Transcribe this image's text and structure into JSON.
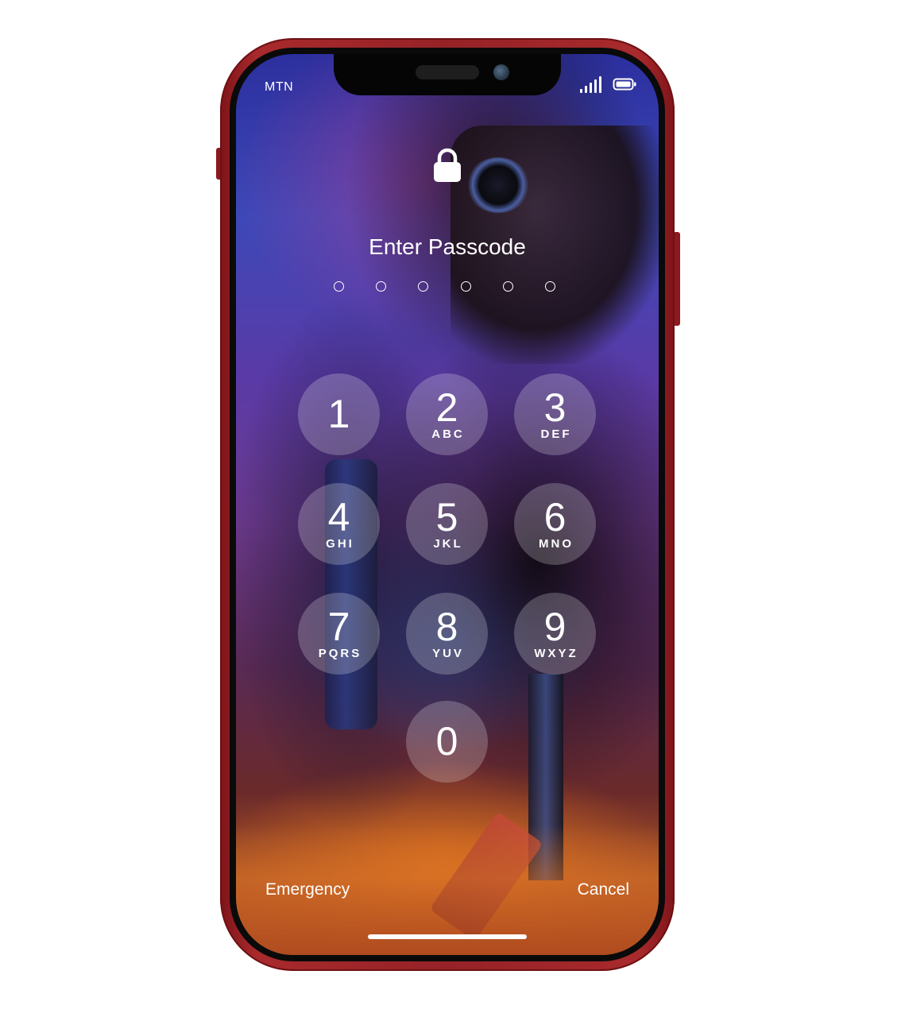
{
  "status_bar": {
    "carrier": "MTN",
    "signal_icon": "cellular-signal-icon",
    "battery_icon": "battery-icon"
  },
  "lock": {
    "icon": "lock-icon",
    "title": "Enter Passcode",
    "passcode_length": 6,
    "entered_digits": 0
  },
  "keypad": {
    "keys": [
      {
        "digit": "1",
        "letters": ""
      },
      {
        "digit": "2",
        "letters": "ABC"
      },
      {
        "digit": "3",
        "letters": "DEF"
      },
      {
        "digit": "4",
        "letters": "GHI"
      },
      {
        "digit": "5",
        "letters": "JKL"
      },
      {
        "digit": "6",
        "letters": "MNO"
      },
      {
        "digit": "7",
        "letters": "PQRS"
      },
      {
        "digit": "8",
        "letters": "YUV"
      },
      {
        "digit": "9",
        "letters": "WXYZ"
      },
      {
        "digit": "0",
        "letters": ""
      }
    ]
  },
  "bottom": {
    "emergency_label": "Emergency",
    "cancel_label": "Cancel"
  },
  "colors": {
    "phone_body": "#962227",
    "key_fill": "rgba(255,255,255,0.22)",
    "text": "#ffffff"
  }
}
